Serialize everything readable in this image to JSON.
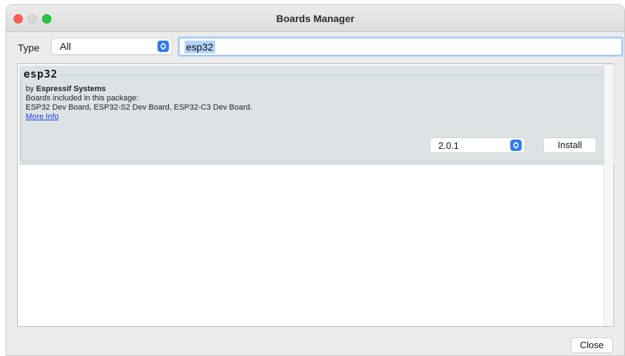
{
  "window": {
    "title": "Boards Manager"
  },
  "filter": {
    "type_label": "Type",
    "type_value": "All",
    "search_value": "esp32"
  },
  "packages": [
    {
      "name": "esp32",
      "by_prefix": "by",
      "author": "Espressif Systems",
      "boards_heading": "Boards included in this package:",
      "boards": "ESP32 Dev Board, ESP32-S2 Dev Board, ESP32-C3 Dev Board.",
      "more_info": "More Info",
      "version": "2.0.1",
      "install_label": "Install"
    }
  ],
  "footer": {
    "close_label": "Close"
  },
  "icons": {
    "stepper": "up-down-chevron-icon"
  },
  "colors": {
    "accent": "#2f7bf5",
    "selection": "#b3d4ff",
    "package_bg": "#dde3e5",
    "link": "#1f3fe0"
  }
}
